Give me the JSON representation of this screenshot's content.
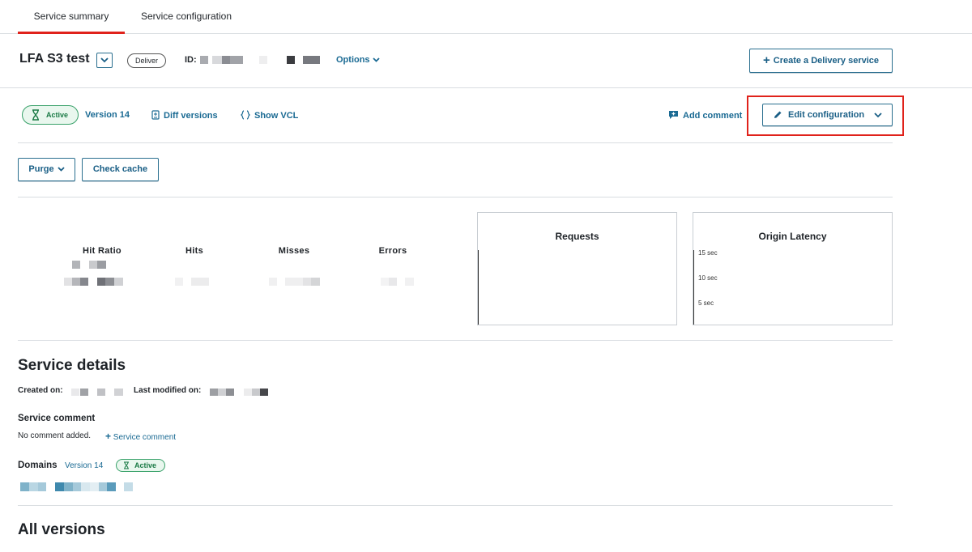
{
  "tabs": {
    "summary": "Service summary",
    "configuration": "Service configuration"
  },
  "service": {
    "name": "LFA S3 test",
    "type_badge": "Deliver",
    "id_label": "ID:",
    "options_label": "Options",
    "create_button": "Create a Delivery service"
  },
  "version_bar": {
    "status": "Active",
    "version": "Version 14",
    "diff_versions": "Diff versions",
    "show_vcl": "Show VCL",
    "add_comment": "Add comment",
    "edit_configuration": "Edit configuration"
  },
  "actions": {
    "purge": "Purge",
    "check_cache": "Check cache"
  },
  "stats": {
    "hit_ratio": "Hit Ratio",
    "hits": "Hits",
    "misses": "Misses",
    "errors": "Errors"
  },
  "charts": {
    "requests_title": "Requests",
    "latency_title": "Origin Latency",
    "latency_ticks": [
      "15 sec",
      "10 sec",
      "5 sec"
    ]
  },
  "details": {
    "title": "Service details",
    "created_on": "Created on:",
    "last_modified": "Last modified on:",
    "comment_heading": "Service comment",
    "no_comment": "No comment added.",
    "add_service_comment": "Service comment",
    "domains_heading": "Domains",
    "domains_version": "Version 14",
    "domains_status": "Active"
  },
  "all_versions": {
    "title": "All versions"
  },
  "colors": {
    "accent_link": "#1a6a93",
    "highlight": "#e0221b",
    "active_green": "#38a169"
  }
}
